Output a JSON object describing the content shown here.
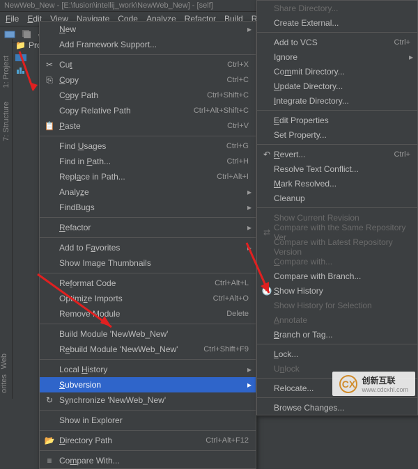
{
  "title": "NewWeb_New - [E:\\fusion\\intellij_work\\NewWeb_New] - [self]",
  "menubar": {
    "file": "File",
    "edit": "Edit",
    "view": "View",
    "navigate": "Navigate",
    "code": "Code",
    "analyze": "Analyze",
    "refactor": "Refactor",
    "build": "Build",
    "run": "Run"
  },
  "sidebar": {
    "project": "1: Project",
    "structure": "7: Structure",
    "web": "Web",
    "favorites": "orites"
  },
  "project_tab": "Pro",
  "menu1": {
    "new": "New",
    "add_framework": "Add Framework Support...",
    "cut": "Cut",
    "cut_sc": "Ctrl+X",
    "copy": "Copy",
    "copy_sc": "Ctrl+C",
    "copy_path": "Copy Path",
    "copy_path_sc": "Ctrl+Shift+C",
    "copy_relative": "Copy Relative Path",
    "copy_relative_sc": "Ctrl+Alt+Shift+C",
    "paste": "Paste",
    "paste_sc": "Ctrl+V",
    "find_usages": "Find Usages",
    "find_usages_sc": "Ctrl+G",
    "find_in_path": "Find in Path...",
    "find_in_path_sc": "Ctrl+H",
    "replace_in_path": "Replace in Path...",
    "replace_in_path_sc": "Ctrl+Alt+I",
    "analyze": "Analyze",
    "findbugs": "FindBugs",
    "refactor": "Refactor",
    "add_favorites": "Add to Favorites",
    "show_thumbnails": "Show Image Thumbnails",
    "reformat": "Reformat Code",
    "reformat_sc": "Ctrl+Alt+L",
    "optimize": "Optimize Imports",
    "optimize_sc": "Ctrl+Alt+O",
    "remove_module": "Remove Module",
    "remove_module_sc": "Delete",
    "build_module": "Build Module 'NewWeb_New'",
    "rebuild_module": "Rebuild Module 'NewWeb_New'",
    "rebuild_module_sc": "Ctrl+Shift+F9",
    "local_history": "Local History",
    "subversion": "Subversion",
    "synchronize": "Synchronize 'NewWeb_New'",
    "show_explorer": "Show in Explorer",
    "directory_path": "Directory Path",
    "directory_path_sc": "Ctrl+Alt+F12",
    "compare_with": "Compare With..."
  },
  "menu2": {
    "share_dir": "Share Directory...",
    "create_external": "Create External...",
    "add_vcs": "Add to VCS",
    "add_vcs_sc": "Ctrl+",
    "ignore": "Ignore",
    "commit_dir": "Commit Directory...",
    "update_dir": "Update Directory...",
    "integrate_dir": "Integrate Directory...",
    "edit_props": "Edit Properties",
    "set_prop": "Set Property...",
    "revert": "Revert...",
    "revert_sc": "Ctrl+",
    "resolve_conflict": "Resolve Text Conflict...",
    "mark_resolved": "Mark Resolved...",
    "cleanup": "Cleanup",
    "show_current_rev": "Show Current Revision",
    "compare_same_repo": "Compare with the Same Repository Ver",
    "compare_latest_repo": "Compare with Latest Repository Version",
    "compare_with": "Compare with...",
    "compare_branch": "Compare with Branch...",
    "show_history": "Show History",
    "show_history_sel": "Show History for Selection",
    "annotate": "Annotate",
    "branch_tag": "Branch or Tag...",
    "lock": "Lock...",
    "unlock": "Unlock",
    "relocate": "Relocate...",
    "browse_changes": "Browse Changes..."
  },
  "watermark": {
    "text": "创新互联",
    "sub": "www.cdcxhl.com"
  }
}
